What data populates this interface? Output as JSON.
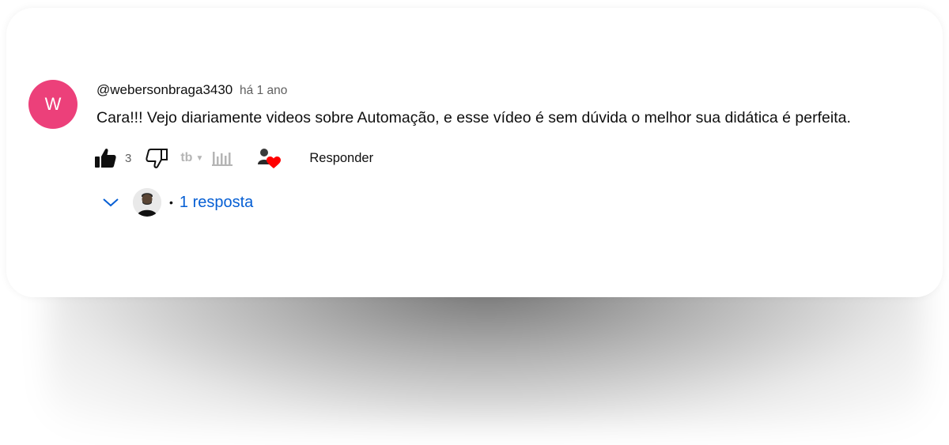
{
  "comment": {
    "avatar_letter": "W",
    "avatar_color": "#ec407a",
    "username": "@webersonbraga3430",
    "timestamp": "há 1 ano",
    "text": "Cara!!! Vejo diariamente videos sobre Automação, e esse vídeo é sem dúvida o melhor sua didática é perfeita.",
    "like_count": "3",
    "tb_label": "tb",
    "reply_label": "Responder"
  },
  "replies": {
    "toggle_icon": "chevron-down-icon",
    "dot": "•",
    "label": "1 resposta",
    "link_color": "#065fd4"
  }
}
